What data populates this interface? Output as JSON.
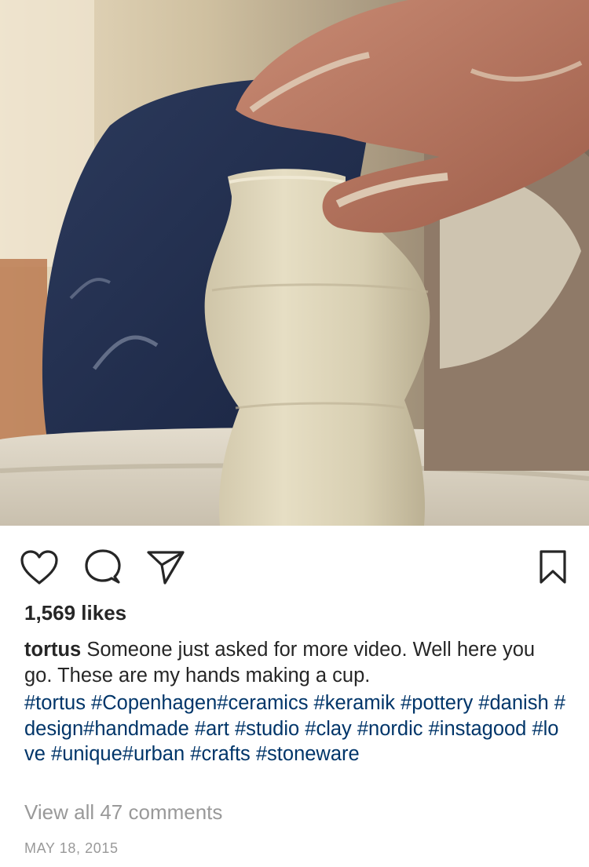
{
  "media": {
    "description_icon": "pottery-wheel-photo"
  },
  "actions": {
    "like_icon": "heart-icon",
    "comment_icon": "comment-icon",
    "share_icon": "paper-plane-icon",
    "save_icon": "bookmark-icon"
  },
  "likes": {
    "text": "1,569 likes"
  },
  "caption": {
    "username": "tortus",
    "text": "Someone just asked for more video.  Well here you go.  These are my hands making a cup."
  },
  "hashtags": {
    "text": "#tortus #Copenhagen#ceramics #keramik #pottery #danish #design#handmade #art #studio #clay #nordic #instagood #love #unique#urban #crafts #stoneware"
  },
  "comments": {
    "view_all": "View all 47 comments"
  },
  "timestamp": {
    "text": "MAY 18, 2015"
  },
  "colors": {
    "text": "#262626",
    "hashtag": "#003569",
    "muted": "#999999",
    "background": "#ffffff"
  }
}
